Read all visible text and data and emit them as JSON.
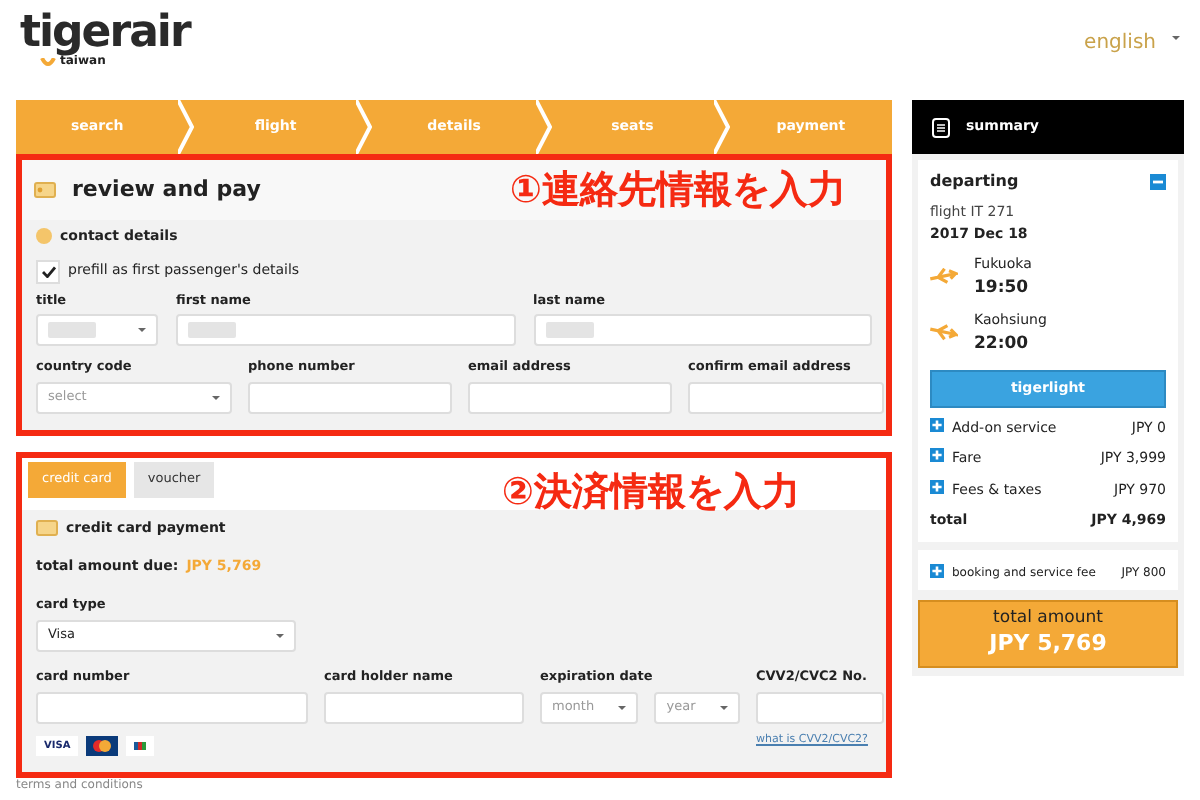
{
  "header": {
    "logo": {
      "name": "tigerair",
      "sub": "taiwan"
    },
    "language": "english"
  },
  "steps": [
    "search",
    "flight",
    "details",
    "seats",
    "payment"
  ],
  "contact_section": {
    "title": "review and pay",
    "annotation": "①連絡先情報を入力",
    "subtitle": "contact details",
    "prefill": {
      "label": "prefill as first passenger's details",
      "checked": true
    },
    "rows": [
      [
        {
          "label": "title",
          "kind": "select",
          "redacted": true
        },
        {
          "label": "first name",
          "kind": "text",
          "redacted": true
        },
        {
          "label": "last name",
          "kind": "text",
          "redacted": true
        }
      ],
      [
        {
          "label": "country code",
          "kind": "select",
          "placeholder": "select"
        },
        {
          "label": "phone number",
          "kind": "text"
        },
        {
          "label": "email address",
          "kind": "text"
        },
        {
          "label": "confirm email address",
          "kind": "text"
        }
      ]
    ]
  },
  "payment_section": {
    "tabs": [
      {
        "label": "credit card",
        "selected": true
      },
      {
        "label": "voucher",
        "selected": false
      }
    ],
    "annotation": "②決済情報を入力",
    "title": "credit card payment",
    "amount_label": "total amount due:",
    "amount": "JPY 5,769",
    "card_type": {
      "label": "card type",
      "value": "Visa"
    },
    "fields": [
      {
        "label": "card number",
        "kind": "text"
      },
      {
        "label": "card holder name",
        "kind": "text"
      },
      {
        "label": "expiration date",
        "kind": "date",
        "selects": [
          "month",
          "year"
        ]
      },
      {
        "label": "CVV2/CVC2 No.",
        "kind": "text",
        "link": "what is CVV2/CVC2?"
      }
    ],
    "card_logos": [
      {
        "kind": "visa",
        "text": "VISA"
      },
      {
        "kind": "mastercard"
      },
      {
        "kind": "jcb"
      }
    ]
  },
  "footer_text": "terms and conditions",
  "summary": {
    "title": "summary",
    "flight": {
      "heading": "departing",
      "expanded": true,
      "flight_no": "flight IT 271",
      "date": "2017 Dec 18",
      "legs": [
        {
          "city": "Fukuoka",
          "time": "19:50",
          "kind": "departure"
        },
        {
          "city": "Kaohsiung",
          "time": "22:00",
          "kind": "arrival"
        }
      ],
      "fare_button": "tigerlight",
      "items": [
        {
          "label": "Add-on service",
          "amount": "JPY 0"
        },
        {
          "label": "Fare",
          "amount": "JPY 3,999"
        },
        {
          "label": "Fees & taxes",
          "amount": "JPY 970"
        }
      ],
      "total": {
        "label": "total",
        "amount": "JPY 4,969"
      }
    },
    "fees": [
      {
        "label": "booking and service fee",
        "amount": "JPY 800"
      }
    ],
    "total_amount": {
      "label": "total amount",
      "amount": "JPY 5,769"
    }
  }
}
